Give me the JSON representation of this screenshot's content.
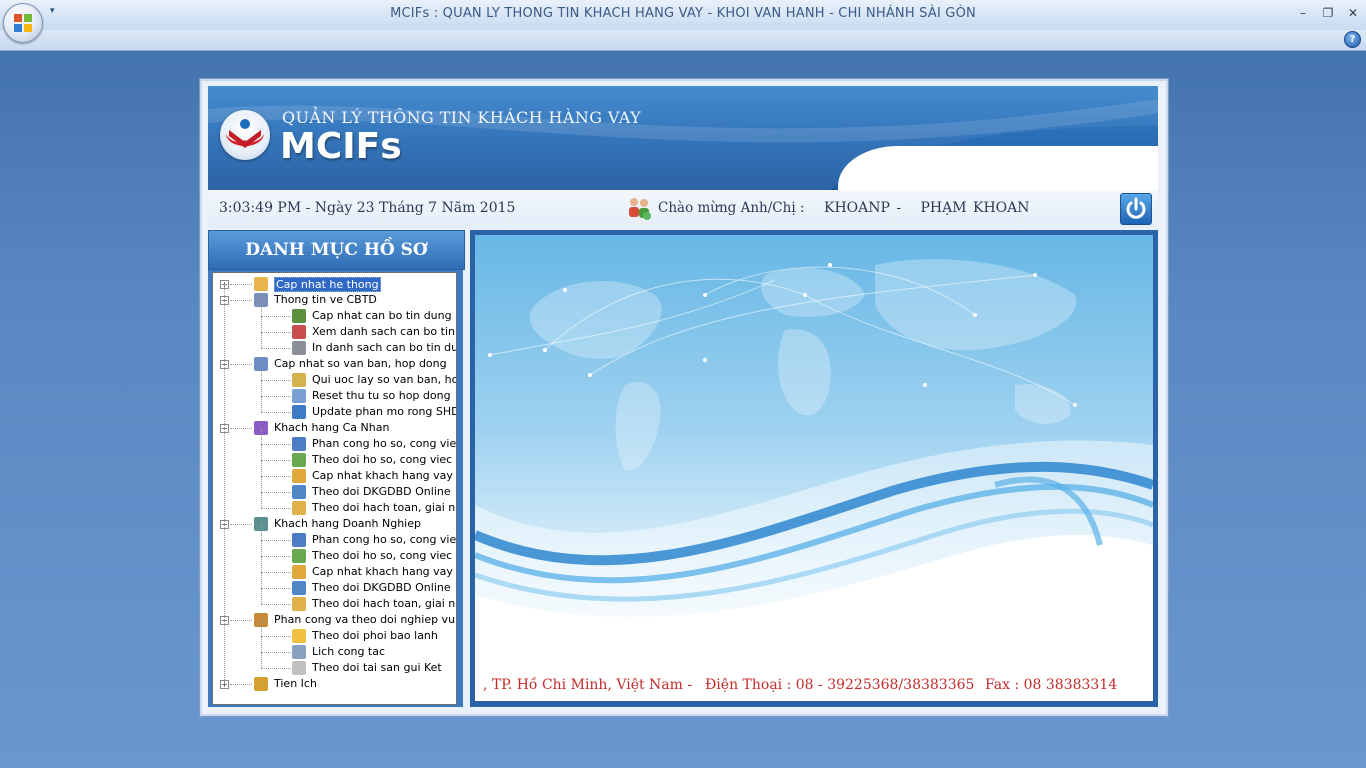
{
  "window": {
    "title": "MCIFs : QUAN LY THONG TIN KHACH HANG VAY - KHOI VAN HANH - CHI NHÁNH SÀI GÒN",
    "minimize": "–",
    "restore": "❐",
    "close": "✕",
    "qa_arrow": "▾",
    "help": "?"
  },
  "banner": {
    "subtitle": "QUẢN LÝ THÔNG TIN KHÁCH HÀNG VAY",
    "title": "MCIFs"
  },
  "infobar": {
    "clock": "3:03:49 PM - Ngày 23 Tháng 7 Năm 2015",
    "welcome": "Chào mừng Anh/Chị :",
    "user": "KHOANP -   PHẠM KHOAN"
  },
  "sidebar": {
    "heading": "DANH MỤC HỒ SƠ",
    "tree": [
      {
        "label": "Cap nhat he thong",
        "level": 0,
        "expander": "+",
        "icon": "settings-icon",
        "selected": true
      },
      {
        "label": "Thong tin ve CBTD",
        "level": 0,
        "expander": "−",
        "icon": "users-icon"
      },
      {
        "label": "Cap nhat can bo tin dung",
        "level": 1,
        "icon": "user-group-icon"
      },
      {
        "label": "Xem danh sach can bo tin dung",
        "level": 1,
        "icon": "list-icon"
      },
      {
        "label": "In danh sach can bo tin dung",
        "level": 1,
        "icon": "print-icon"
      },
      {
        "label": "Cap nhat so van ban, hop dong",
        "level": 0,
        "expander": "−",
        "icon": "book-icon"
      },
      {
        "label": "Qui uoc lay so van ban, hop dong",
        "level": 1,
        "icon": "edit-icon"
      },
      {
        "label": "Reset thu tu so hop dong",
        "level": 1,
        "icon": "reset-icon"
      },
      {
        "label": "Update phan mo rong SHD",
        "level": 1,
        "icon": "update-icon"
      },
      {
        "label": "Khach hang Ca Nhan",
        "level": 0,
        "expander": "−",
        "icon": "person-icon"
      },
      {
        "label": "Phan cong ho so, cong viec",
        "level": 1,
        "icon": "assign-icon"
      },
      {
        "label": "Theo doi ho so, cong viec",
        "level": 1,
        "icon": "table-icon"
      },
      {
        "label": "Cap nhat khach hang vay",
        "level": 1,
        "icon": "chart-icon"
      },
      {
        "label": "Theo doi DKGDBD Online",
        "level": 1,
        "icon": "online-icon"
      },
      {
        "label": "Theo doi hach toan, giai ngan",
        "level": 1,
        "icon": "money-icon"
      },
      {
        "label": "Khach hang Doanh Nghiep",
        "level": 0,
        "expander": "−",
        "icon": "company-icon"
      },
      {
        "label": "Phan cong ho so, cong viec",
        "level": 1,
        "icon": "assign-icon"
      },
      {
        "label": "Theo doi ho so, cong viec",
        "level": 1,
        "icon": "table-icon"
      },
      {
        "label": "Cap nhat khach hang vay",
        "level": 1,
        "icon": "chart-icon"
      },
      {
        "label": "Theo doi DKGDBD Online",
        "level": 1,
        "icon": "online-icon"
      },
      {
        "label": "Theo doi hach toan, giai ngan",
        "level": 1,
        "icon": "money-icon"
      },
      {
        "label": "Phan cong va theo doi nghiep vu khac",
        "level": 0,
        "expander": "−",
        "icon": "tasks-icon"
      },
      {
        "label": "Theo doi phoi bao lanh",
        "level": 1,
        "icon": "folder-icon"
      },
      {
        "label": "Lich cong tac",
        "level": 1,
        "icon": "calendar-icon"
      },
      {
        "label": "Theo doi tai san gui Ket",
        "level": 1,
        "icon": "document-icon"
      },
      {
        "label": "Tien Ich",
        "level": 0,
        "expander": "+",
        "icon": "tools-icon"
      }
    ]
  },
  "footer": {
    "address": ", TP. Hồ Chi Minh, Việt Nam -",
    "phone": "Điện Thoại : 08 - 39225368/38383365",
    "fax": "Fax : 08 38383314"
  },
  "colors": {
    "accent": "#2e6db5",
    "footer_text": "#c42a2a",
    "selection": "#3169c6"
  }
}
